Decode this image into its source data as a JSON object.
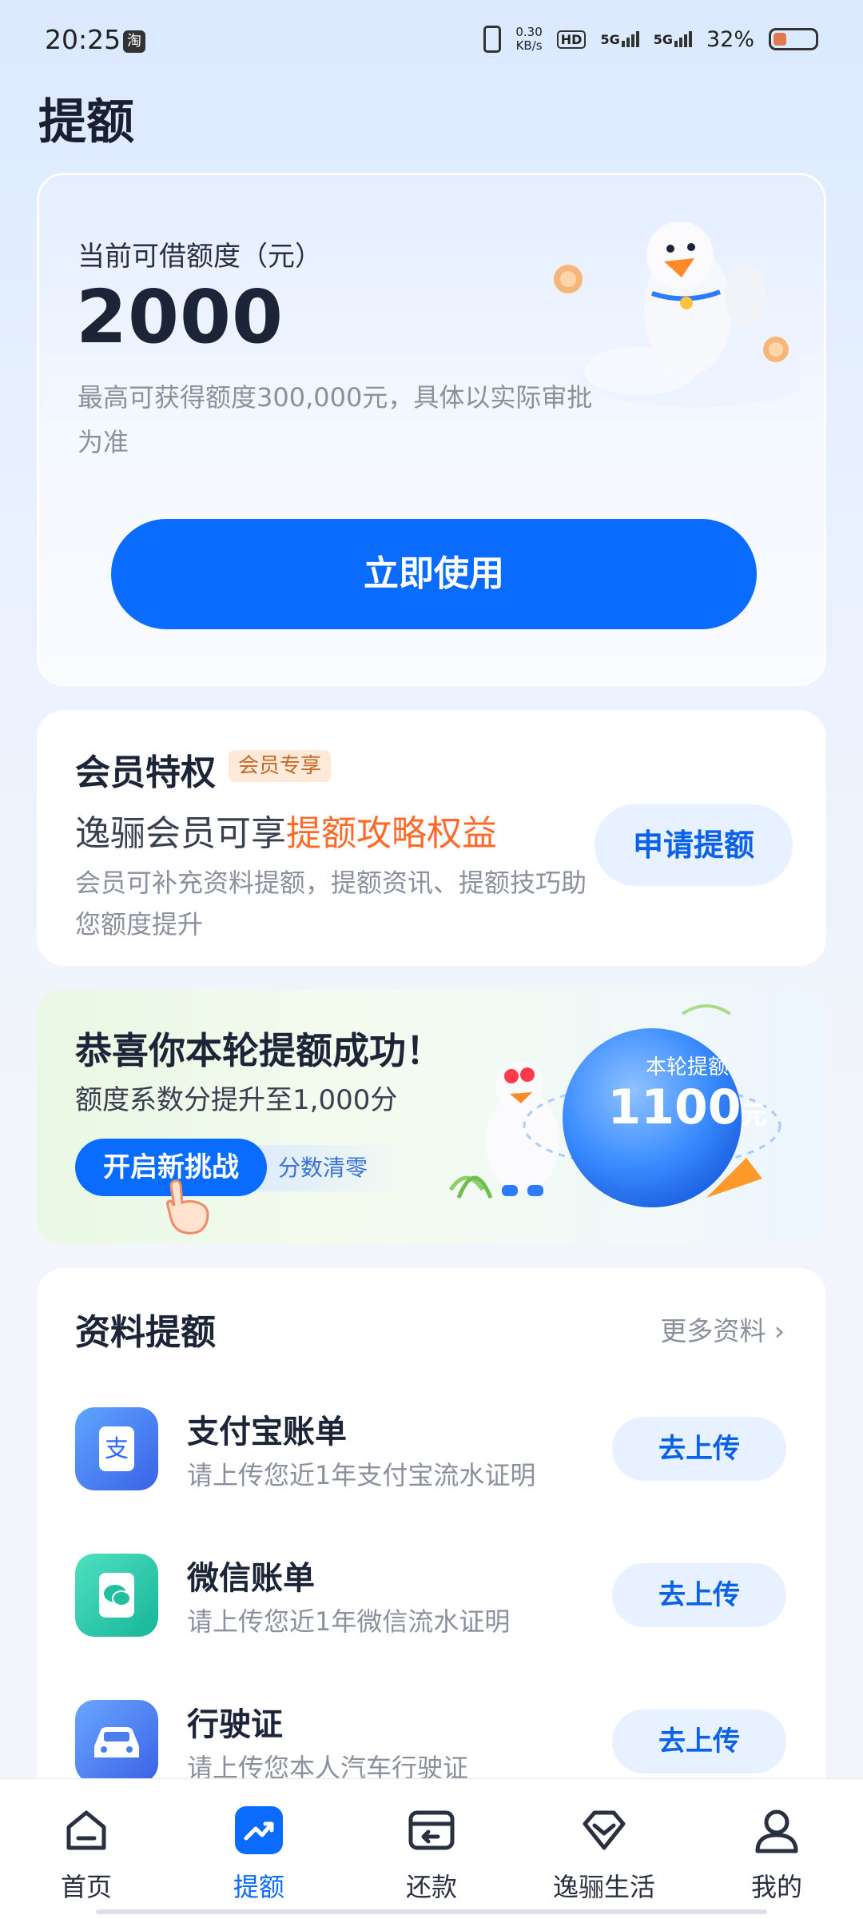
{
  "status_bar": {
    "time": "20:25",
    "app_icon": "淘",
    "speed_value": "0.30",
    "speed_unit": "KB/s",
    "hd": "HD",
    "net1": "5G",
    "net2": "5G",
    "battery": "32%"
  },
  "page": {
    "title": "提额"
  },
  "credit": {
    "label": "当前可借额度（元）",
    "amount": "2000",
    "note": "最高可获得额度300,000元，具体以实际审批为准",
    "button": "立即使用"
  },
  "member": {
    "title": "会员特权",
    "badge": "会员专享",
    "line_prefix": "逸骊会员可享",
    "line_highlight": "提额攻略权益",
    "desc": "会员可补充资料提额，提额资讯、提额技巧助您额度提升",
    "button": "申请提额"
  },
  "congrats": {
    "title": "恭喜你本轮提额成功！",
    "subtitle": "额度系数分提升至1,000分",
    "button": "开启新挑战",
    "tag": "分数清零",
    "orb_label": "本轮提额",
    "orb_value": "1100",
    "orb_unit": "元"
  },
  "docs": {
    "title": "资料提额",
    "more": "更多资料 ›",
    "items": [
      {
        "name": "支付宝账单",
        "desc": "请上传您近1年支付宝流水证明",
        "button": "去上传",
        "icon": "alipay-icon"
      },
      {
        "name": "微信账单",
        "desc": "请上传您近1年微信流水证明",
        "button": "去上传",
        "icon": "wechat-icon"
      },
      {
        "name": "行驶证",
        "desc": "请上传您本人汽车行驶证",
        "button": "去上传",
        "icon": "car-icon"
      }
    ]
  },
  "nav": {
    "items": [
      {
        "label": "首页",
        "icon": "home-icon"
      },
      {
        "label": "提额",
        "icon": "trend-up-icon",
        "active": true
      },
      {
        "label": "还款",
        "icon": "repay-icon"
      },
      {
        "label": "逸骊生活",
        "icon": "diamond-icon"
      },
      {
        "label": "我的",
        "icon": "person-icon"
      }
    ]
  },
  "colors": {
    "primary": "#0a6cff",
    "highlight": "#ff6a2a",
    "button_soft": "#e7f1ff"
  }
}
